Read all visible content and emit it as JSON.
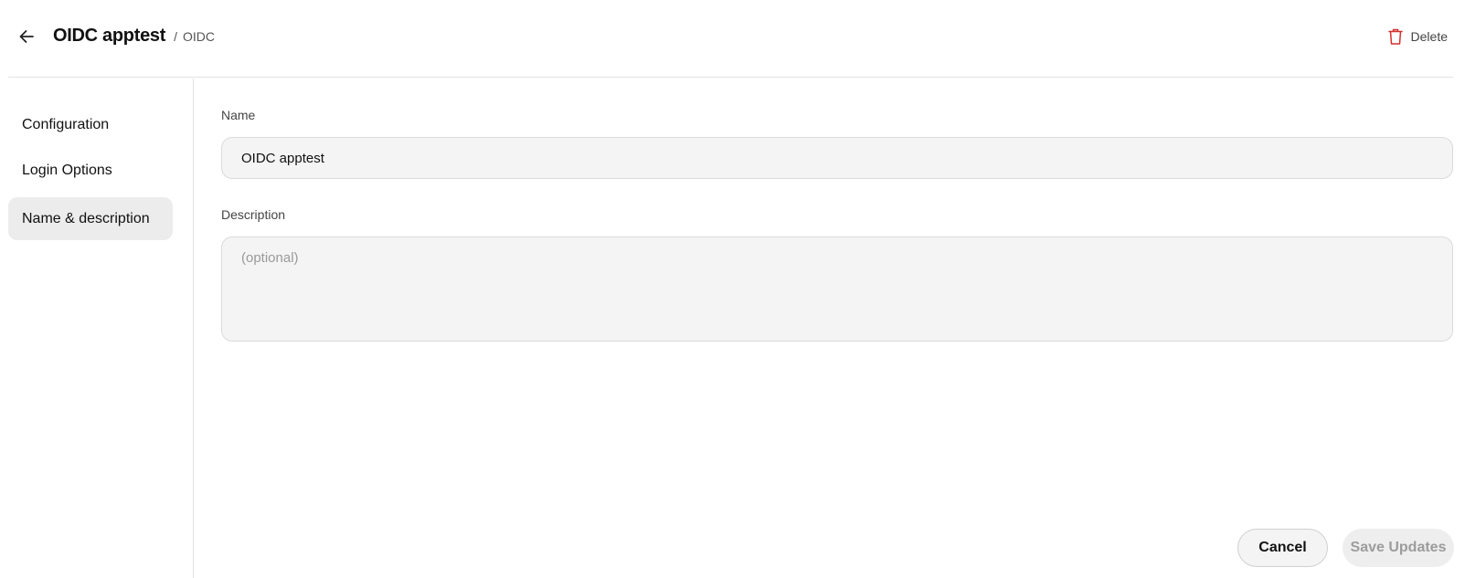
{
  "header": {
    "back_icon": "arrow-left-icon",
    "title": "OIDC apptest",
    "breadcrumb_separator": "/",
    "breadcrumb": "OIDC",
    "delete_icon": "trash-icon",
    "delete_label": "Delete",
    "delete_color": "#d32f2f"
  },
  "sidebar": {
    "items": [
      {
        "label": "Configuration",
        "active": false
      },
      {
        "label": "Login Options",
        "active": false
      },
      {
        "label": "Name & description",
        "active": true
      }
    ]
  },
  "form": {
    "name_label": "Name",
    "name_value": "OIDC apptest",
    "description_label": "Description",
    "description_value": "",
    "description_placeholder": "(optional)"
  },
  "footer": {
    "cancel_label": "Cancel",
    "save_label": "Save Updates"
  }
}
